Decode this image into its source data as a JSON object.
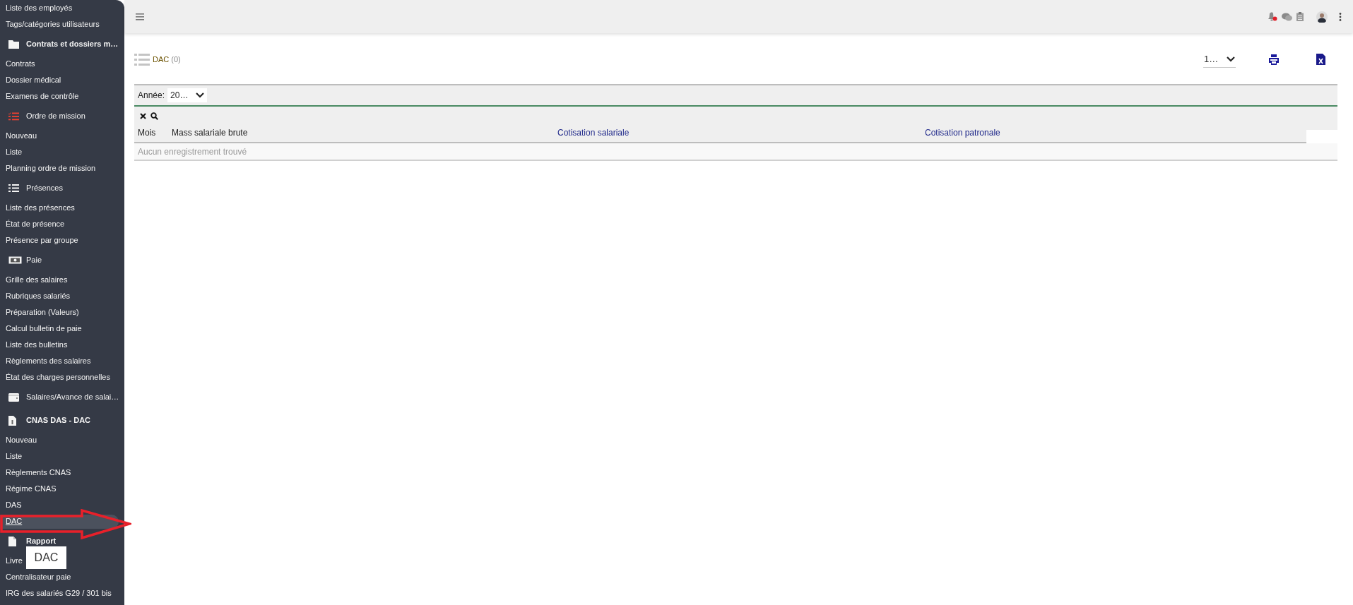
{
  "sidebar": {
    "items": [
      {
        "kind": "link",
        "label": "Liste des employés",
        "selected": false
      },
      {
        "kind": "link",
        "label": "Tags/catégories utilisateurs",
        "selected": false
      },
      {
        "kind": "header",
        "label": "Contrats et dossiers m…",
        "bold": true
      },
      {
        "kind": "link",
        "label": "Contrats",
        "selected": false
      },
      {
        "kind": "link",
        "label": "Dossier médical",
        "selected": false
      },
      {
        "kind": "link",
        "label": "Examens de contrôle",
        "selected": false
      },
      {
        "kind": "header",
        "label": "Ordre de mission",
        "bold": false
      },
      {
        "kind": "link",
        "label": "Nouveau",
        "selected": false
      },
      {
        "kind": "link",
        "label": "Liste",
        "selected": false
      },
      {
        "kind": "link",
        "label": "Planning ordre de mission",
        "selected": false
      },
      {
        "kind": "header",
        "label": "Présences",
        "bold": false
      },
      {
        "kind": "link",
        "label": "Liste des présences",
        "selected": false
      },
      {
        "kind": "link",
        "label": "État de présence",
        "selected": false
      },
      {
        "kind": "link",
        "label": "Présence par groupe",
        "selected": false
      },
      {
        "kind": "header",
        "label": "Paie",
        "bold": false
      },
      {
        "kind": "link",
        "label": "Grille des salaires",
        "selected": false
      },
      {
        "kind": "link",
        "label": "Rubriques salariés",
        "selected": false
      },
      {
        "kind": "link",
        "label": "Préparation (Valeurs)",
        "selected": false
      },
      {
        "kind": "link",
        "label": "Calcul bulletin de paie",
        "selected": false
      },
      {
        "kind": "link",
        "label": "Liste des bulletins",
        "selected": false
      },
      {
        "kind": "link",
        "label": "Règlements des salaires",
        "selected": false
      },
      {
        "kind": "link",
        "label": "État des charges personnelles",
        "selected": false
      },
      {
        "kind": "header",
        "label": "Salaires/Avance de salai…",
        "bold": false
      },
      {
        "kind": "header",
        "label": "CNAS DAS - DAC",
        "bold": true
      },
      {
        "kind": "link",
        "label": "Nouveau",
        "selected": false
      },
      {
        "kind": "link",
        "label": "Liste",
        "selected": false
      },
      {
        "kind": "link",
        "label": "Règlements CNAS",
        "selected": false
      },
      {
        "kind": "link",
        "label": "Régime CNAS",
        "selected": false
      },
      {
        "kind": "link",
        "label": "DAS",
        "selected": false
      },
      {
        "kind": "link",
        "label": "DAC",
        "selected": true
      },
      {
        "kind": "header",
        "label": "Rapport",
        "bold": true
      },
      {
        "kind": "link",
        "label": "Livre",
        "selected": false
      },
      {
        "kind": "link",
        "label": "Centralisateur paie",
        "selected": false
      },
      {
        "kind": "link",
        "label": "IRG des salariés G29 / 301 bis",
        "selected": false
      }
    ]
  },
  "tooltip": {
    "text": "DAC"
  },
  "topbar": {
    "bell_unread": true
  },
  "page": {
    "title": "DAC",
    "count": "(0)",
    "page_size": "1…"
  },
  "filter": {
    "label": "Année:",
    "value": "20…"
  },
  "table": {
    "columns": [
      {
        "label": "Mois",
        "kind": "plain"
      },
      {
        "label": "Mass salariale brute",
        "kind": "plain"
      },
      {
        "label": "Cotisation salariale",
        "kind": "link"
      },
      {
        "label": "Cotisation patronale",
        "kind": "link"
      }
    ],
    "empty_message": "Aucun enregistrement trouvé"
  }
}
